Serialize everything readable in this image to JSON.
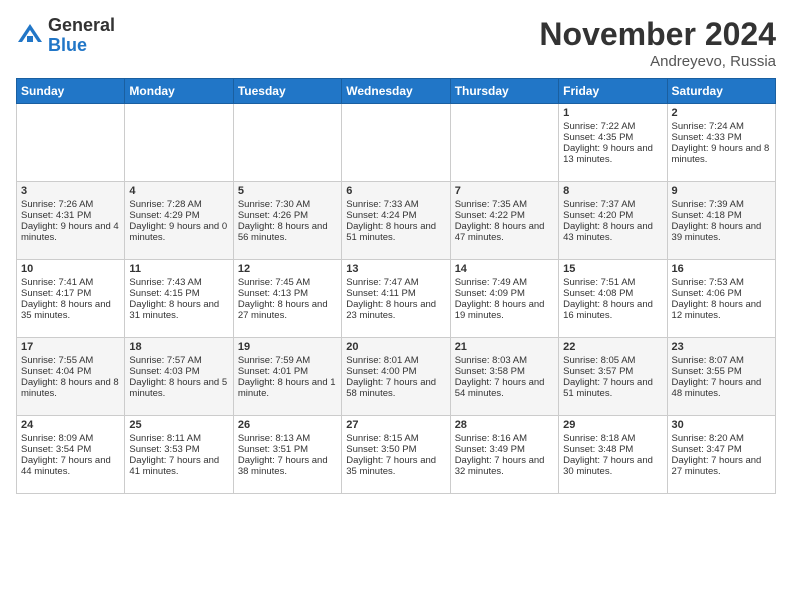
{
  "logo": {
    "general": "General",
    "blue": "Blue"
  },
  "title": "November 2024",
  "location": "Andreyevo, Russia",
  "days": [
    "Sunday",
    "Monday",
    "Tuesday",
    "Wednesday",
    "Thursday",
    "Friday",
    "Saturday"
  ],
  "weeks": [
    [
      {
        "day": "",
        "text": ""
      },
      {
        "day": "",
        "text": ""
      },
      {
        "day": "",
        "text": ""
      },
      {
        "day": "",
        "text": ""
      },
      {
        "day": "",
        "text": ""
      },
      {
        "day": "1",
        "text": "Sunrise: 7:22 AM\nSunset: 4:35 PM\nDaylight: 9 hours and 13 minutes."
      },
      {
        "day": "2",
        "text": "Sunrise: 7:24 AM\nSunset: 4:33 PM\nDaylight: 9 hours and 8 minutes."
      }
    ],
    [
      {
        "day": "3",
        "text": "Sunrise: 7:26 AM\nSunset: 4:31 PM\nDaylight: 9 hours and 4 minutes."
      },
      {
        "day": "4",
        "text": "Sunrise: 7:28 AM\nSunset: 4:29 PM\nDaylight: 9 hours and 0 minutes."
      },
      {
        "day": "5",
        "text": "Sunrise: 7:30 AM\nSunset: 4:26 PM\nDaylight: 8 hours and 56 minutes."
      },
      {
        "day": "6",
        "text": "Sunrise: 7:33 AM\nSunset: 4:24 PM\nDaylight: 8 hours and 51 minutes."
      },
      {
        "day": "7",
        "text": "Sunrise: 7:35 AM\nSunset: 4:22 PM\nDaylight: 8 hours and 47 minutes."
      },
      {
        "day": "8",
        "text": "Sunrise: 7:37 AM\nSunset: 4:20 PM\nDaylight: 8 hours and 43 minutes."
      },
      {
        "day": "9",
        "text": "Sunrise: 7:39 AM\nSunset: 4:18 PM\nDaylight: 8 hours and 39 minutes."
      }
    ],
    [
      {
        "day": "10",
        "text": "Sunrise: 7:41 AM\nSunset: 4:17 PM\nDaylight: 8 hours and 35 minutes."
      },
      {
        "day": "11",
        "text": "Sunrise: 7:43 AM\nSunset: 4:15 PM\nDaylight: 8 hours and 31 minutes."
      },
      {
        "day": "12",
        "text": "Sunrise: 7:45 AM\nSunset: 4:13 PM\nDaylight: 8 hours and 27 minutes."
      },
      {
        "day": "13",
        "text": "Sunrise: 7:47 AM\nSunset: 4:11 PM\nDaylight: 8 hours and 23 minutes."
      },
      {
        "day": "14",
        "text": "Sunrise: 7:49 AM\nSunset: 4:09 PM\nDaylight: 8 hours and 19 minutes."
      },
      {
        "day": "15",
        "text": "Sunrise: 7:51 AM\nSunset: 4:08 PM\nDaylight: 8 hours and 16 minutes."
      },
      {
        "day": "16",
        "text": "Sunrise: 7:53 AM\nSunset: 4:06 PM\nDaylight: 8 hours and 12 minutes."
      }
    ],
    [
      {
        "day": "17",
        "text": "Sunrise: 7:55 AM\nSunset: 4:04 PM\nDaylight: 8 hours and 8 minutes."
      },
      {
        "day": "18",
        "text": "Sunrise: 7:57 AM\nSunset: 4:03 PM\nDaylight: 8 hours and 5 minutes."
      },
      {
        "day": "19",
        "text": "Sunrise: 7:59 AM\nSunset: 4:01 PM\nDaylight: 8 hours and 1 minute."
      },
      {
        "day": "20",
        "text": "Sunrise: 8:01 AM\nSunset: 4:00 PM\nDaylight: 7 hours and 58 minutes."
      },
      {
        "day": "21",
        "text": "Sunrise: 8:03 AM\nSunset: 3:58 PM\nDaylight: 7 hours and 54 minutes."
      },
      {
        "day": "22",
        "text": "Sunrise: 8:05 AM\nSunset: 3:57 PM\nDaylight: 7 hours and 51 minutes."
      },
      {
        "day": "23",
        "text": "Sunrise: 8:07 AM\nSunset: 3:55 PM\nDaylight: 7 hours and 48 minutes."
      }
    ],
    [
      {
        "day": "24",
        "text": "Sunrise: 8:09 AM\nSunset: 3:54 PM\nDaylight: 7 hours and 44 minutes."
      },
      {
        "day": "25",
        "text": "Sunrise: 8:11 AM\nSunset: 3:53 PM\nDaylight: 7 hours and 41 minutes."
      },
      {
        "day": "26",
        "text": "Sunrise: 8:13 AM\nSunset: 3:51 PM\nDaylight: 7 hours and 38 minutes."
      },
      {
        "day": "27",
        "text": "Sunrise: 8:15 AM\nSunset: 3:50 PM\nDaylight: 7 hours and 35 minutes."
      },
      {
        "day": "28",
        "text": "Sunrise: 8:16 AM\nSunset: 3:49 PM\nDaylight: 7 hours and 32 minutes."
      },
      {
        "day": "29",
        "text": "Sunrise: 8:18 AM\nSunset: 3:48 PM\nDaylight: 7 hours and 30 minutes."
      },
      {
        "day": "30",
        "text": "Sunrise: 8:20 AM\nSunset: 3:47 PM\nDaylight: 7 hours and 27 minutes."
      }
    ]
  ],
  "colors": {
    "header_bg": "#2176c7",
    "header_text": "#ffffff",
    "cell_bg_odd": "#ffffff",
    "cell_bg_even": "#f5f5f5"
  }
}
